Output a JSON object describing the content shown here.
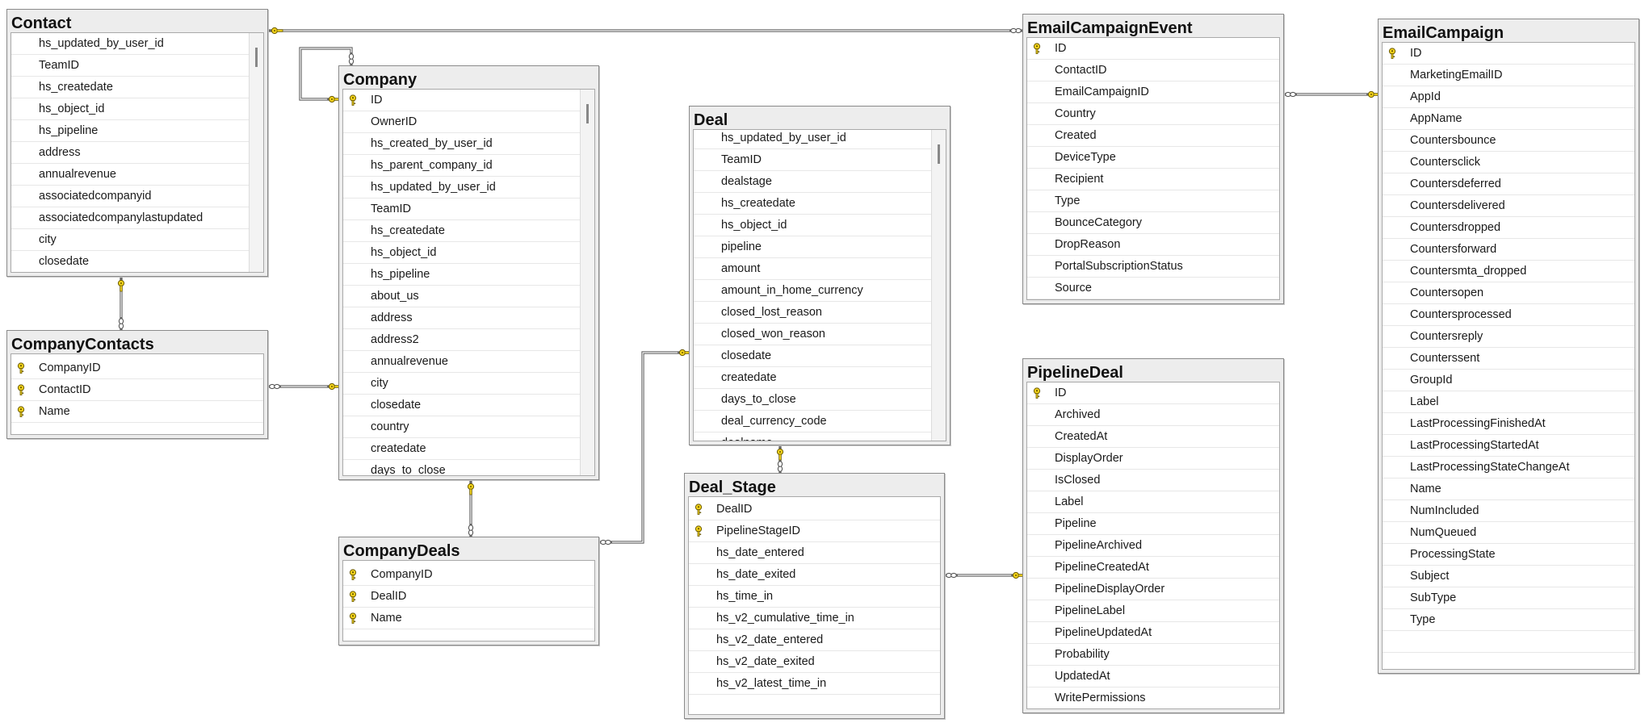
{
  "diagram": {
    "tables": [
      {
        "id": "contact",
        "name": "Contact",
        "scrollbar": true,
        "columns": [
          {
            "name": "hs_updated_by_user_id",
            "key": false
          },
          {
            "name": "TeamID",
            "key": false
          },
          {
            "name": "hs_createdate",
            "key": false
          },
          {
            "name": "hs_object_id",
            "key": false
          },
          {
            "name": "hs_pipeline",
            "key": false
          },
          {
            "name": "address",
            "key": false
          },
          {
            "name": "annualrevenue",
            "key": false
          },
          {
            "name": "associatedcompanyid",
            "key": false
          },
          {
            "name": "associatedcompanylastupdated",
            "key": false
          },
          {
            "name": "city",
            "key": false
          },
          {
            "name": "closedate",
            "key": false
          }
        ]
      },
      {
        "id": "companycontacts",
        "name": "CompanyContacts",
        "scrollbar": false,
        "columns": [
          {
            "name": "CompanyID",
            "key": true
          },
          {
            "name": "ContactID",
            "key": true
          },
          {
            "name": "Name",
            "key": true
          }
        ]
      },
      {
        "id": "company",
        "name": "Company",
        "scrollbar": true,
        "columns": [
          {
            "name": "ID",
            "key": true
          },
          {
            "name": "OwnerID",
            "key": false
          },
          {
            "name": "hs_created_by_user_id",
            "key": false
          },
          {
            "name": "hs_parent_company_id",
            "key": false
          },
          {
            "name": "hs_updated_by_user_id",
            "key": false
          },
          {
            "name": "TeamID",
            "key": false
          },
          {
            "name": "hs_createdate",
            "key": false
          },
          {
            "name": "hs_object_id",
            "key": false
          },
          {
            "name": "hs_pipeline",
            "key": false
          },
          {
            "name": "about_us",
            "key": false
          },
          {
            "name": "address",
            "key": false
          },
          {
            "name": "address2",
            "key": false
          },
          {
            "name": "annualrevenue",
            "key": false
          },
          {
            "name": "city",
            "key": false
          },
          {
            "name": "closedate",
            "key": false
          },
          {
            "name": "country",
            "key": false
          },
          {
            "name": "createdate",
            "key": false
          },
          {
            "name": "days_to_close",
            "key": false
          }
        ]
      },
      {
        "id": "companydeals",
        "name": "CompanyDeals",
        "scrollbar": false,
        "columns": [
          {
            "name": "CompanyID",
            "key": true
          },
          {
            "name": "DealID",
            "key": true
          },
          {
            "name": "Name",
            "key": true
          }
        ]
      },
      {
        "id": "deal",
        "name": "Deal",
        "scrollbar": true,
        "columns": [
          {
            "name": "hs_updated_by_user_id",
            "key": false
          },
          {
            "name": "TeamID",
            "key": false
          },
          {
            "name": "dealstage",
            "key": false
          },
          {
            "name": "hs_createdate",
            "key": false
          },
          {
            "name": "hs_object_id",
            "key": false
          },
          {
            "name": "pipeline",
            "key": false
          },
          {
            "name": "amount",
            "key": false
          },
          {
            "name": "amount_in_home_currency",
            "key": false
          },
          {
            "name": "closed_lost_reason",
            "key": false
          },
          {
            "name": "closed_won_reason",
            "key": false
          },
          {
            "name": "closedate",
            "key": false
          },
          {
            "name": "createdate",
            "key": false
          },
          {
            "name": "days_to_close",
            "key": false
          },
          {
            "name": "deal_currency_code",
            "key": false
          },
          {
            "name": "dealname",
            "key": false
          }
        ]
      },
      {
        "id": "dealstage",
        "name": "Deal_Stage",
        "scrollbar": false,
        "columns": [
          {
            "name": "DealID",
            "key": true
          },
          {
            "name": "PipelineStageID",
            "key": true
          },
          {
            "name": "hs_date_entered",
            "key": false
          },
          {
            "name": "hs_date_exited",
            "key": false
          },
          {
            "name": "hs_time_in",
            "key": false
          },
          {
            "name": "hs_v2_cumulative_time_in",
            "key": false
          },
          {
            "name": "hs_v2_date_entered",
            "key": false
          },
          {
            "name": "hs_v2_date_exited",
            "key": false
          },
          {
            "name": "hs_v2_latest_time_in",
            "key": false
          }
        ]
      },
      {
        "id": "emailcampaignevent",
        "name": "EmailCampaignEvent",
        "scrollbar": false,
        "columns": [
          {
            "name": "ID",
            "key": true
          },
          {
            "name": "ContactID",
            "key": false
          },
          {
            "name": "EmailCampaignID",
            "key": false
          },
          {
            "name": "Country",
            "key": false
          },
          {
            "name": "Created",
            "key": false
          },
          {
            "name": "DeviceType",
            "key": false
          },
          {
            "name": "Recipient",
            "key": false
          },
          {
            "name": "Type",
            "key": false
          },
          {
            "name": "BounceCategory",
            "key": false
          },
          {
            "name": "DropReason",
            "key": false
          },
          {
            "name": "PortalSubscriptionStatus",
            "key": false
          },
          {
            "name": "Source",
            "key": false
          }
        ]
      },
      {
        "id": "pipelinedeal",
        "name": "PipelineDeal",
        "scrollbar": false,
        "columns": [
          {
            "name": "ID",
            "key": true
          },
          {
            "name": "Archived",
            "key": false
          },
          {
            "name": "CreatedAt",
            "key": false
          },
          {
            "name": "DisplayOrder",
            "key": false
          },
          {
            "name": "IsClosed",
            "key": false
          },
          {
            "name": "Label",
            "key": false
          },
          {
            "name": "Pipeline",
            "key": false
          },
          {
            "name": "PipelineArchived",
            "key": false
          },
          {
            "name": "PipelineCreatedAt",
            "key": false
          },
          {
            "name": "PipelineDisplayOrder",
            "key": false
          },
          {
            "name": "PipelineLabel",
            "key": false
          },
          {
            "name": "PipelineUpdatedAt",
            "key": false
          },
          {
            "name": "Probability",
            "key": false
          },
          {
            "name": "UpdatedAt",
            "key": false
          },
          {
            "name": "WritePermissions",
            "key": false
          }
        ]
      },
      {
        "id": "emailcampaign",
        "name": "EmailCampaign",
        "scrollbar": false,
        "columns": [
          {
            "name": "ID",
            "key": true
          },
          {
            "name": "MarketingEmailID",
            "key": false
          },
          {
            "name": "AppId",
            "key": false
          },
          {
            "name": "AppName",
            "key": false
          },
          {
            "name": "Countersbounce",
            "key": false
          },
          {
            "name": "Countersclick",
            "key": false
          },
          {
            "name": "Countersdeferred",
            "key": false
          },
          {
            "name": "Countersdelivered",
            "key": false
          },
          {
            "name": "Countersdropped",
            "key": false
          },
          {
            "name": "Countersforward",
            "key": false
          },
          {
            "name": "Countersmta_dropped",
            "key": false
          },
          {
            "name": "Countersopen",
            "key": false
          },
          {
            "name": "Countersprocessed",
            "key": false
          },
          {
            "name": "Countersreply",
            "key": false
          },
          {
            "name": "Counterssent",
            "key": false
          },
          {
            "name": "GroupId",
            "key": false
          },
          {
            "name": "Label",
            "key": false
          },
          {
            "name": "LastProcessingFinishedAt",
            "key": false
          },
          {
            "name": "LastProcessingStartedAt",
            "key": false
          },
          {
            "name": "LastProcessingStateChangeAt",
            "key": false
          },
          {
            "name": "Name",
            "key": false
          },
          {
            "name": "NumIncluded",
            "key": false
          },
          {
            "name": "NumQueued",
            "key": false
          },
          {
            "name": "ProcessingState",
            "key": false
          },
          {
            "name": "Subject",
            "key": false
          },
          {
            "name": "SubType",
            "key": false
          },
          {
            "name": "Type",
            "key": false
          }
        ]
      }
    ],
    "relationships": [
      {
        "id": "contact-emailcampaignevent",
        "from": "contact",
        "to": "emailcampaignevent"
      },
      {
        "id": "emailcampaignevent-emailcampaign",
        "from": "emailcampaignevent",
        "to": "emailcampaign"
      },
      {
        "id": "company-self",
        "from": "company",
        "to": "company"
      },
      {
        "id": "contact-companycontacts",
        "from": "contact",
        "to": "companycontacts"
      },
      {
        "id": "companycontacts-company",
        "from": "companycontacts",
        "to": "company"
      },
      {
        "id": "company-companydeals",
        "from": "company",
        "to": "companydeals"
      },
      {
        "id": "companydeals-deal",
        "from": "companydeals",
        "to": "deal"
      },
      {
        "id": "deal-dealstage",
        "from": "deal",
        "to": "dealstage"
      },
      {
        "id": "dealstage-pipelinedeal",
        "from": "dealstage",
        "to": "pipelinedeal"
      }
    ],
    "colors": {
      "key_icon": "#f2d21b",
      "key_outline": "#6b5a00",
      "relationship_line": "#555555",
      "title_bar": "#ededed",
      "grid_background": "#ffffff"
    }
  }
}
